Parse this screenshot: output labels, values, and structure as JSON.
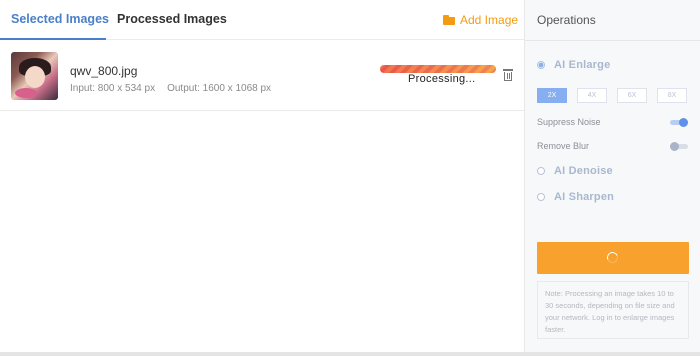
{
  "tabs": {
    "selected": "Selected Images",
    "processed": "Processed Images"
  },
  "add_image": "Add Image",
  "image": {
    "filename": "qwv_800.jpg",
    "input": "Input: 800 x 534 px",
    "output": "Output: 1600 x 1068 px",
    "status": "Processing...",
    "progress": 1.0
  },
  "operations": {
    "title": "Operations",
    "enlarge": {
      "label": "AI Enlarge",
      "selected": true,
      "scales": [
        "2X",
        "4X",
        "6X",
        "8X"
      ],
      "active_scale": "2X",
      "suppress_noise": {
        "label": "Suppress Noise",
        "on": true
      },
      "remove_blur": {
        "label": "Remove Blur",
        "on": false
      }
    },
    "denoise": {
      "label": "AI Denoise",
      "selected": false
    },
    "sharpen": {
      "label": "AI Sharpen",
      "selected": false
    },
    "note": "Note: Processing an image takes 10 to 30 seconds, depending on file size and your network. Log in to enlarge images faster."
  },
  "colors": {
    "accent_blue": "#4a7fc9",
    "accent_orange": "#f8a12c"
  }
}
